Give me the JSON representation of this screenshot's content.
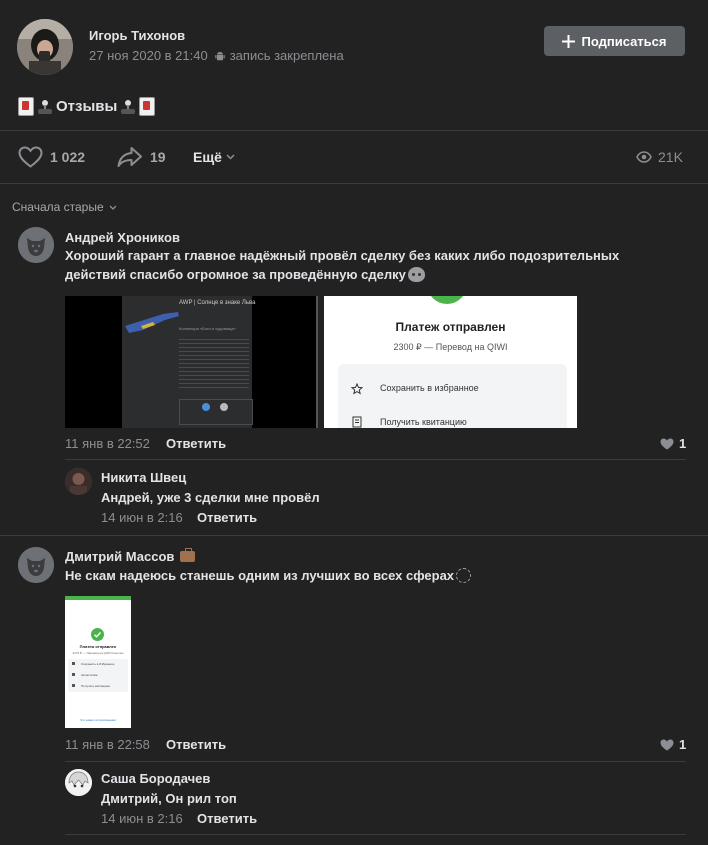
{
  "post": {
    "author": "Игорь Тихонов",
    "date": "27 ноя 2020 в 21:40",
    "pinned": "запись закреплена",
    "subscribe_label": "Подписаться",
    "text": "Отзывы",
    "likes": "1 022",
    "shares": "19",
    "more_label": "Ещё",
    "views": "21K",
    "sort_label": "Сначала старые"
  },
  "comments": [
    {
      "author": "Андрей Хроников",
      "text_line1": "Хороший гарант а главное надёжный провёл сделку без каких либо подозрительных",
      "text_line2": "действий спасибо огромное за проведённую сделку",
      "date": "11 янв в 22:52",
      "reply_label": "Ответить",
      "likes": "1",
      "images": [
        {
          "title": "AWP | Солнце в знаке Льва",
          "label": "Коллекция «Боги и чудовища»"
        },
        {
          "heading": "Платеж отправлен",
          "amount": "2300 ₽ — Перевод на QIWI",
          "action1": "Сохранить в избранное",
          "action2": "Получить квитанцию"
        }
      ],
      "replies": [
        {
          "author": "Никита Швец",
          "text": "Андрей, уже 3 сделки мне провёл",
          "date": "14 июн в 2:16",
          "reply_label": "Ответить"
        }
      ]
    },
    {
      "author": "Дмитрий Массов",
      "text": "Не скам надеюсь станешь одним из лучших во всех сферах",
      "date": "11 янв в 22:58",
      "reply_label": "Ответить",
      "likes": "1",
      "image": {
        "heading": "Платеж отправлен",
        "amount": "2473 ₽ — Перевод на QIWI Кошелек",
        "action1": "Сохранить в Избранное",
        "action2": "Автоплатёж",
        "action3": "Получить квитанцию",
        "footer": "Что нового в приложении"
      },
      "replies": [
        {
          "author": "Саша Бородачев",
          "text": "Дмитрий, Он рил топ",
          "date": "14 июн в 2:16",
          "reply_label": "Ответить"
        }
      ]
    }
  ],
  "colors": {
    "background": "#222222",
    "text": "#e1e3e6",
    "muted": "#8b8e93",
    "button": "#5c5f63",
    "green": "#4bb34b"
  }
}
